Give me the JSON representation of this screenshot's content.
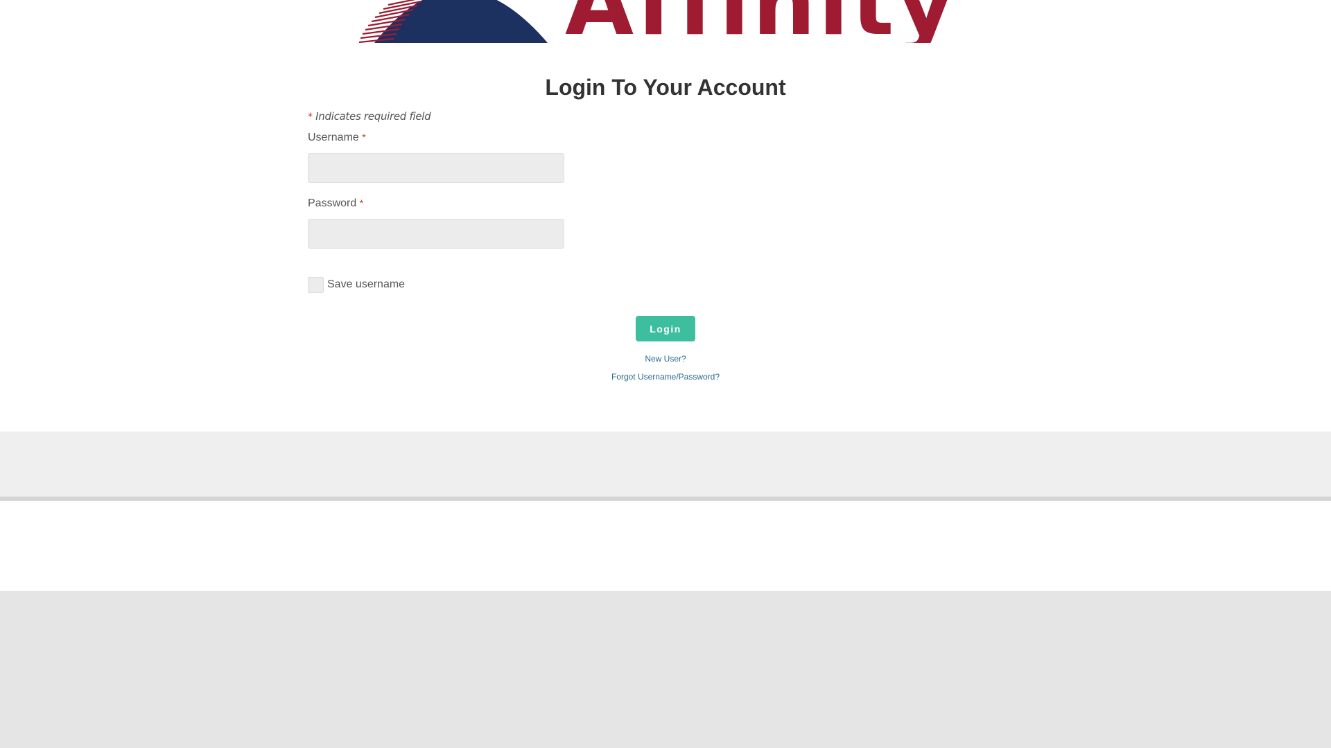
{
  "brand": {
    "logo_text": "Affinity",
    "colors": {
      "red": "#9e1b32",
      "navy": "#1d3160"
    }
  },
  "login": {
    "title": "Login To Your Account",
    "required_asterisk": "*",
    "required_note": "Indicates required field",
    "username_label": "Username",
    "username_value": "",
    "password_label": "Password",
    "password_value": "",
    "save_username_label": "Save username",
    "save_username_checked": false,
    "login_button": "Login",
    "new_user_link": "New User?",
    "forgot_link": "Forgot Username/Password?"
  },
  "colors": {
    "accent": "#3dbf9f",
    "link": "#2a6a8e",
    "required": "#c0392b",
    "input_bg": "#ececec"
  }
}
